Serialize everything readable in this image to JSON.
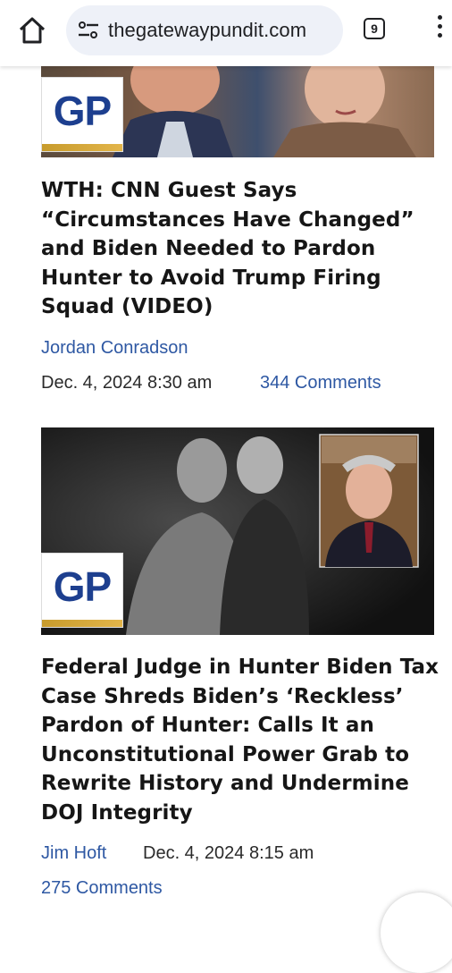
{
  "browser": {
    "url": "thegatewaypundit.com",
    "tab_count": "9",
    "icons": [
      "home-icon",
      "site-settings-icon",
      "tabs-icon",
      "more-vert-icon"
    ]
  },
  "logo_text": "GP",
  "articles": [
    {
      "headline": "WTH: CNN Guest Says “Circumstances Have Changed” and Biden Needed to Pardon Hunter to Avoid Trump Firing Squad (VIDEO)",
      "author": "Jordan Conradson",
      "date": "Dec. 4, 2024 8:30 am",
      "comments": "344 Comments"
    },
    {
      "headline": "Federal Judge in Hunter Biden Tax Case Shreds Biden’s ‘Reckless’ Pardon of Hunter: Calls It an Unconstitutional Power Grab to Rewrite History and Undermine DOJ Integrity",
      "author": "Jim Hoft",
      "date": "Dec. 4, 2024 8:15 am",
      "comments": "275 Comments"
    }
  ],
  "colors": {
    "link": "#2e58a3",
    "logo_blue": "#1d3f8f",
    "logo_gold": "#c79b2c"
  }
}
